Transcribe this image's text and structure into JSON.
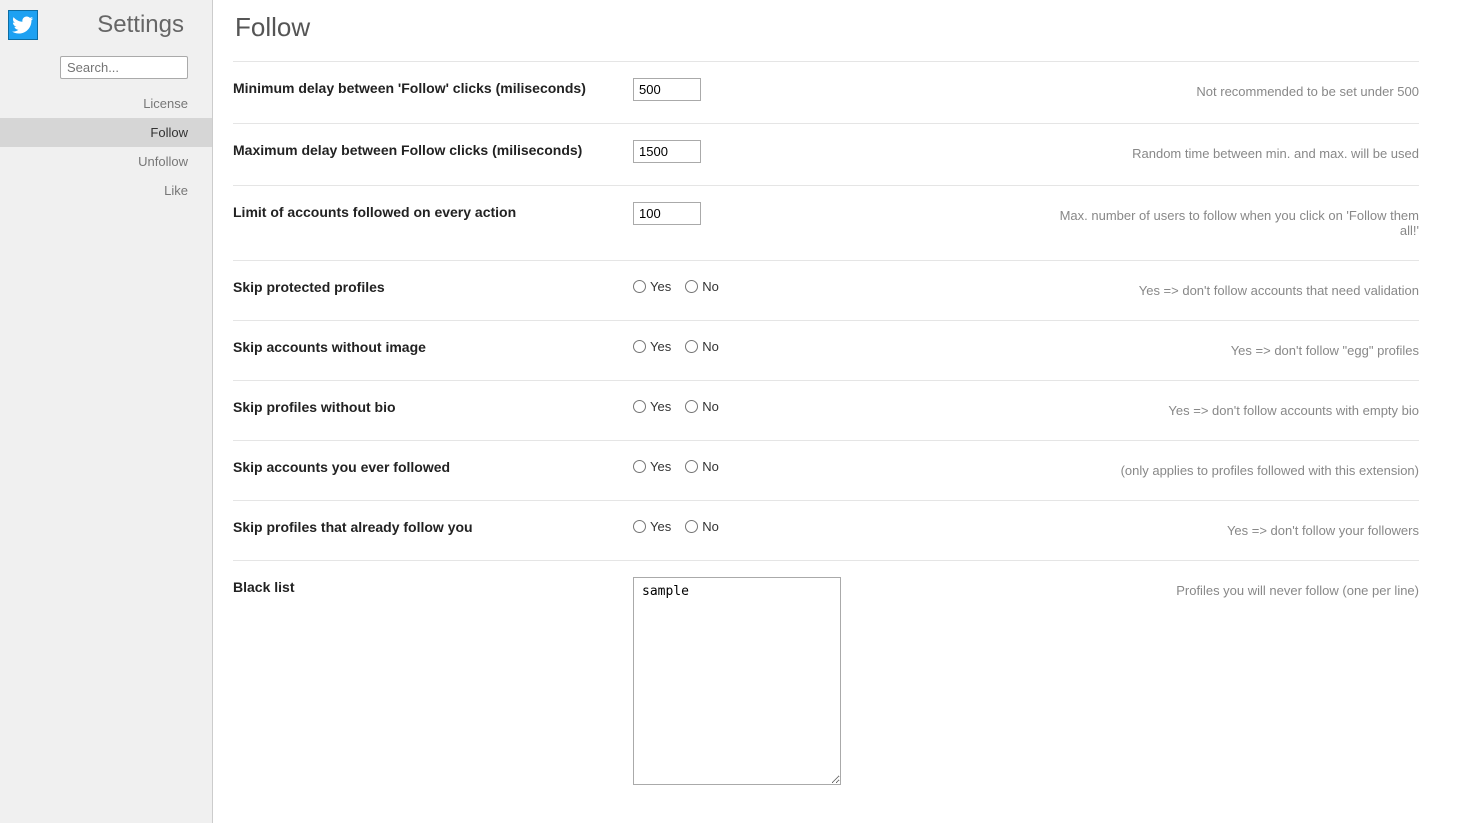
{
  "sidebar": {
    "title": "Settings",
    "search_placeholder": "Search...",
    "nav": [
      {
        "label": "License",
        "active": false
      },
      {
        "label": "Follow",
        "active": true
      },
      {
        "label": "Unfollow",
        "active": false
      },
      {
        "label": "Like",
        "active": false
      }
    ]
  },
  "page": {
    "title": "Follow"
  },
  "radio_labels": {
    "yes": "Yes",
    "no": "No"
  },
  "settings": {
    "min_delay": {
      "label": "Minimum delay between 'Follow' clicks (miliseconds)",
      "value": "500",
      "help": "Not recommended to be set under 500"
    },
    "max_delay": {
      "label": "Maximum delay between Follow clicks (miliseconds)",
      "value": "1500",
      "help": "Random time between min. and max. will be used"
    },
    "limit": {
      "label": "Limit of accounts followed on every action",
      "value": "100",
      "help": "Max. number of users to follow when you click on 'Follow them all!'"
    },
    "skip_protected": {
      "label": "Skip protected profiles",
      "help": "Yes => don't follow accounts that need validation"
    },
    "skip_no_image": {
      "label": "Skip accounts without image",
      "help": "Yes => don't follow \"egg\" profiles"
    },
    "skip_no_bio": {
      "label": "Skip profiles without bio",
      "help": "Yes => don't follow accounts with empty bio"
    },
    "skip_ever_followed": {
      "label": "Skip accounts you ever followed",
      "help": "(only applies to profiles followed with this extension)"
    },
    "skip_followers": {
      "label": "Skip profiles that already follow you",
      "help": "Yes => don't follow your followers"
    },
    "blacklist": {
      "label": "Black list",
      "value": "sample",
      "help": "Profiles you will never follow (one per line)"
    }
  }
}
